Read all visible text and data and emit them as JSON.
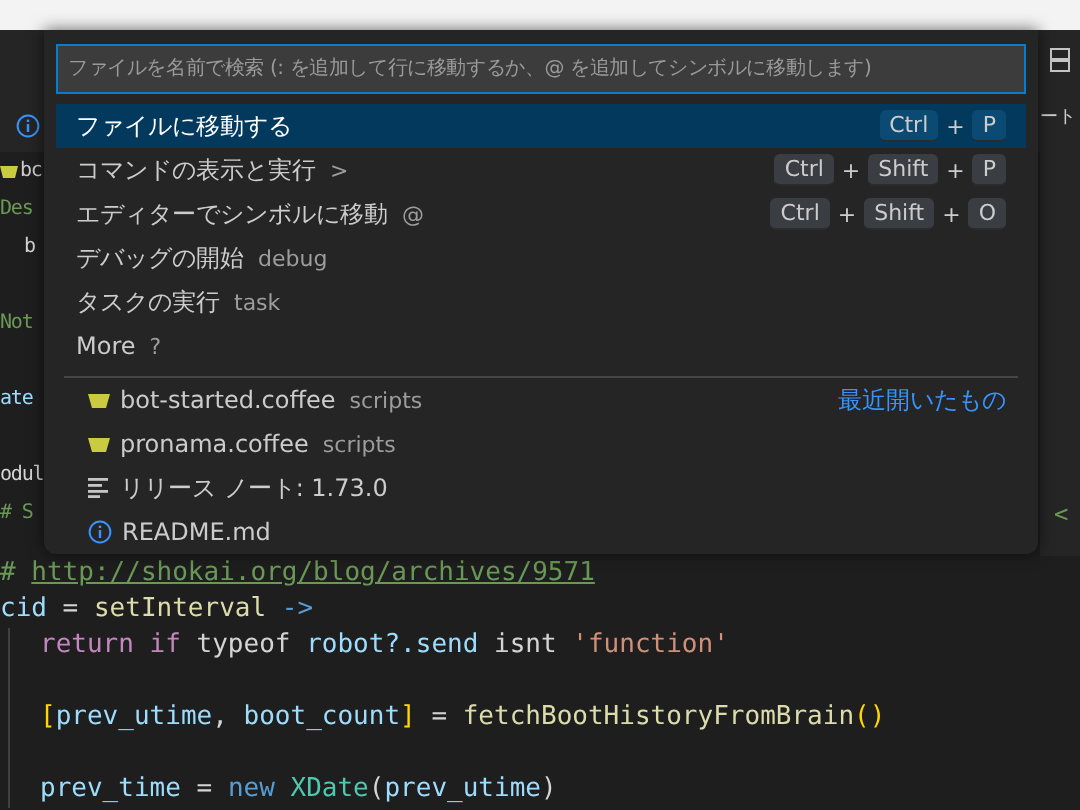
{
  "quick_open": {
    "placeholder": "ファイルを名前で検索 (: を追加して行に移動するか、@ を追加してシンボルに移動します)",
    "commands": [
      {
        "label": "ファイルに移動する",
        "selected": true,
        "keys": [
          {
            "kind": "key",
            "text": "Ctrl"
          },
          {
            "kind": "plus",
            "text": "+"
          },
          {
            "kind": "key",
            "text": "P"
          }
        ]
      },
      {
        "label": "コマンドの表示と実行",
        "hint": ">",
        "selected": false,
        "keys": [
          {
            "kind": "key",
            "text": "Ctrl"
          },
          {
            "kind": "plus",
            "text": "+"
          },
          {
            "kind": "key",
            "text": "Shift"
          },
          {
            "kind": "plus",
            "text": "+"
          },
          {
            "kind": "key",
            "text": "P"
          }
        ]
      },
      {
        "label": "エディターでシンボルに移動",
        "hint": "@",
        "selected": false,
        "keys": [
          {
            "kind": "key",
            "text": "Ctrl"
          },
          {
            "kind": "plus",
            "text": "+"
          },
          {
            "kind": "key",
            "text": "Shift"
          },
          {
            "kind": "plus",
            "text": "+"
          },
          {
            "kind": "key",
            "text": "O"
          }
        ]
      },
      {
        "label": "デバッグの開始",
        "hint": "debug",
        "selected": false
      },
      {
        "label": "タスクの実行",
        "hint": "task",
        "selected": false
      },
      {
        "label": "More",
        "hint": "?",
        "selected": false
      }
    ],
    "recent_label": "最近開いたもの",
    "files": [
      {
        "kind": "coffee",
        "name": "bot-started.coffee",
        "detail": "scripts"
      },
      {
        "kind": "coffee",
        "name": "pronama.coffee",
        "detail": "scripts"
      },
      {
        "kind": "notes",
        "name": "リリース ノート: 1.73.0"
      },
      {
        "kind": "info",
        "name": "README.md"
      }
    ]
  },
  "editor": {
    "left_lines": [
      {
        "kind": "file",
        "text": "bc"
      },
      {
        "kind": "comment",
        "text": "Des"
      },
      {
        "kind": "indent",
        "text": "b"
      },
      {
        "kind": "blank"
      },
      {
        "kind": "comment",
        "text": "Not"
      },
      {
        "kind": "blank"
      },
      {
        "kind": "var",
        "text": "ate"
      },
      {
        "kind": "blank"
      },
      {
        "kind": "plain",
        "text": "odul"
      },
      {
        "kind": "comment",
        "text": "# S"
      }
    ],
    "right_fragments": [
      {
        "kind": "notice",
        "text": "ート"
      },
      {
        "kind": "mark",
        "text": "<"
      }
    ],
    "code_lines": [
      [
        {
          "kind": "comment",
          "text": "# "
        },
        {
          "kind": "link",
          "text": "http://shokai.org/blog/archives/9571"
        }
      ],
      [
        {
          "kind": "var",
          "text": "cid"
        },
        {
          "kind": "plain",
          "text": " = "
        },
        {
          "kind": "func",
          "text": "setInterval"
        },
        {
          "kind": "keyword",
          "text": " ->"
        }
      ],
      [
        {
          "kind": "indent"
        },
        {
          "kind": "control",
          "text": "return"
        },
        {
          "kind": "control",
          "text": " if"
        },
        {
          "kind": "plain",
          "text": " typeof "
        },
        {
          "kind": "var",
          "text": "robot?.send"
        },
        {
          "kind": "plain",
          "text": " isnt "
        },
        {
          "kind": "string",
          "text": "'function'"
        }
      ],
      [
        {
          "kind": "indent"
        }
      ],
      [
        {
          "kind": "indent"
        },
        {
          "kind": "bracket",
          "text": "["
        },
        {
          "kind": "var",
          "text": "prev_utime"
        },
        {
          "kind": "plain",
          "text": ", "
        },
        {
          "kind": "var",
          "text": "boot_count"
        },
        {
          "kind": "bracket",
          "text": "]"
        },
        {
          "kind": "plain",
          "text": " = "
        },
        {
          "kind": "func",
          "text": "fetchBootHistoryFromBrain"
        },
        {
          "kind": "bracket",
          "text": "()"
        }
      ],
      [
        {
          "kind": "indent"
        }
      ],
      [
        {
          "kind": "indent"
        },
        {
          "kind": "var",
          "text": "prev_time"
        },
        {
          "kind": "plain",
          "text": " = "
        },
        {
          "kind": "keyword",
          "text": "new"
        },
        {
          "kind": "class",
          "text": " XDate"
        },
        {
          "kind": "plain",
          "text": "("
        },
        {
          "kind": "var",
          "text": "prev_utime"
        },
        {
          "kind": "plain",
          "text": ")"
        }
      ]
    ]
  }
}
